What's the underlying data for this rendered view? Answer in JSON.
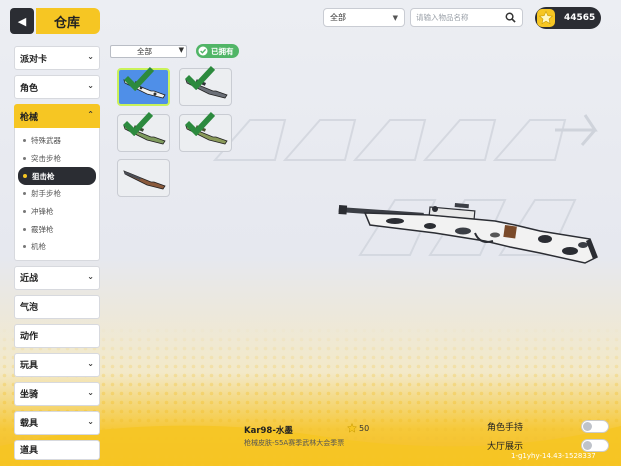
{
  "header": {
    "title": "仓库"
  },
  "toolbar": {
    "filter_value": "全部",
    "search_placeholder": "请输入物品名称",
    "coins": "44565"
  },
  "sidebar": {
    "categories_top": [
      {
        "label": "派对卡"
      },
      {
        "label": "角色"
      }
    ],
    "active_category": {
      "label": "枪械",
      "subitems": [
        {
          "label": "特殊武器"
        },
        {
          "label": "突击步枪"
        },
        {
          "label": "狙击枪"
        },
        {
          "label": "射手步枪"
        },
        {
          "label": "冲锋枪"
        },
        {
          "label": "霰弹枪"
        },
        {
          "label": "机枪"
        }
      ],
      "active_subitem": "狙击枪"
    },
    "categories_bottom": [
      {
        "label": "近战"
      },
      {
        "label": "气泡"
      },
      {
        "label": "动作"
      },
      {
        "label": "玩具"
      },
      {
        "label": "坐骑"
      },
      {
        "label": "载具"
      },
      {
        "label": "道具"
      }
    ]
  },
  "grid": {
    "filter_value": "全部",
    "owned_label": "已拥有",
    "items": [
      {
        "skin": "水墨",
        "owned": true,
        "selected": true
      },
      {
        "skin": "default",
        "owned": true,
        "selected": false
      },
      {
        "skin": "green",
        "owned": true,
        "selected": false
      },
      {
        "skin": "olive",
        "owned": true,
        "selected": false
      },
      {
        "skin": "wood",
        "owned": false,
        "selected": false
      }
    ]
  },
  "detail": {
    "name": "Kar98-水墨",
    "description": "枪械皮肤-S5A赛季武林大会季票",
    "rating": "50"
  },
  "toggles": [
    {
      "label": "角色手持",
      "on": false
    },
    {
      "label": "大厅展示",
      "on": false
    }
  ],
  "build_id": "1-g1yhy-14.43-1528337",
  "colors": {
    "accent": "#f6c623",
    "dark": "#2b2d33",
    "owned": "#51b567",
    "selected_bg": "#4f8fe8",
    "selected_border": "#c9f25a"
  }
}
